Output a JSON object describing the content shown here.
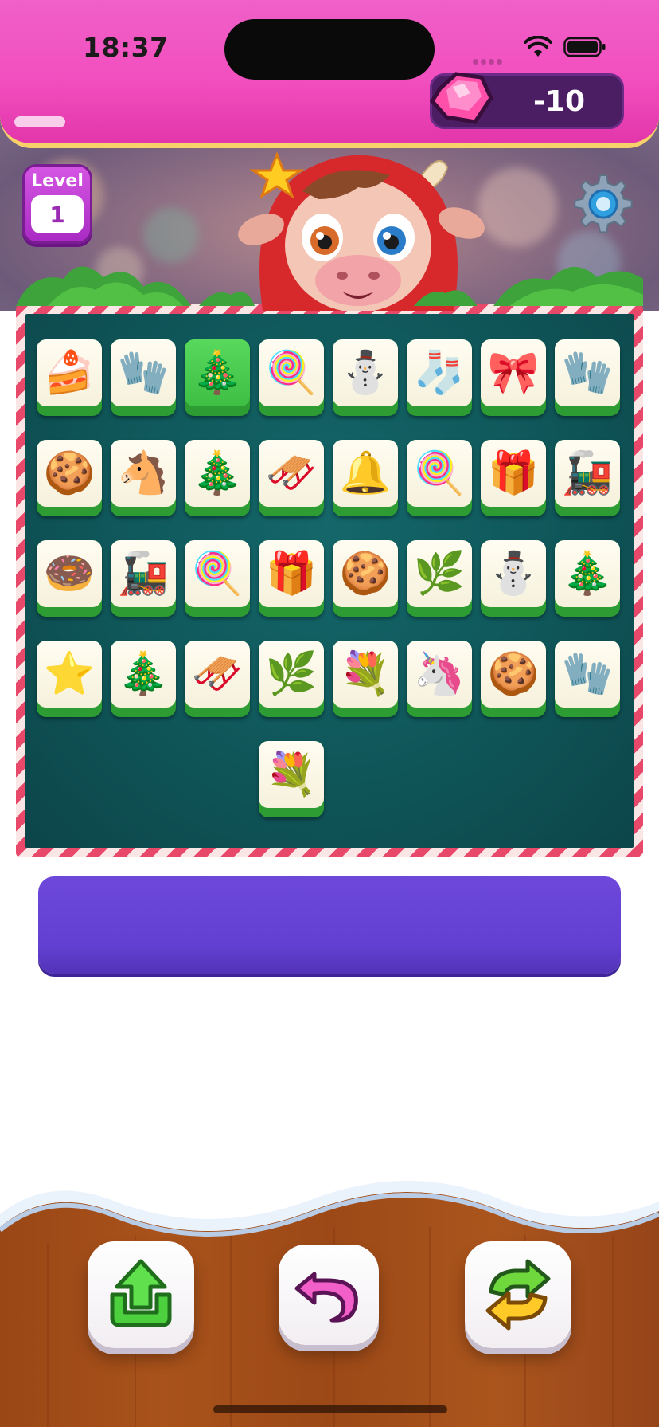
{
  "status_bar": {
    "time": "18:37"
  },
  "currency": {
    "value": "-10",
    "icon": "pink-gem-icon"
  },
  "level": {
    "label": "Level",
    "number": "1"
  },
  "settings": {
    "icon": "gear-icon"
  },
  "colors": {
    "header_pink": "#f24fbf",
    "board_teal": "#0f5659",
    "tile_green": "#2c9c33",
    "tray_purple": "#6340d2",
    "wood_brown": "#a24c17"
  },
  "board": {
    "tiles": [
      {
        "glyph": "🍰",
        "name": "cake-tile",
        "active": false
      },
      {
        "glyph": "🧤",
        "name": "red-mitten-tile",
        "active": false
      },
      {
        "glyph": "🎄",
        "name": "tree-tile",
        "active": true
      },
      {
        "glyph": "🍭",
        "name": "candy-cane-tile",
        "active": false
      },
      {
        "glyph": "⛄",
        "name": "snowman-tile",
        "active": false
      },
      {
        "glyph": "🧦",
        "name": "stocking-tile",
        "active": false
      },
      {
        "glyph": "🎀",
        "name": "ornament-bow-tile",
        "active": false
      },
      {
        "glyph": "🧤",
        "name": "blue-mitten-tile",
        "active": false
      },
      {
        "glyph": "🍪",
        "name": "gingerbread-tile",
        "active": false
      },
      {
        "glyph": "🐴",
        "name": "rocking-horse-tile",
        "active": false
      },
      {
        "glyph": "🎄",
        "name": "tree-cookie-tile",
        "active": false
      },
      {
        "glyph": "🛷",
        "name": "sled-tile",
        "active": false
      },
      {
        "glyph": "🔔",
        "name": "bauble-tile",
        "active": false
      },
      {
        "glyph": "🍭",
        "name": "lollipop-tile",
        "active": false
      },
      {
        "glyph": "🎁",
        "name": "gift-tile",
        "active": false
      },
      {
        "glyph": "🚂",
        "name": "train-tile",
        "active": false
      },
      {
        "glyph": "🍩",
        "name": "donut-tile",
        "active": false
      },
      {
        "glyph": "🚂",
        "name": "train-tile",
        "active": false
      },
      {
        "glyph": "🍭",
        "name": "candy-cane-tile",
        "active": false
      },
      {
        "glyph": "🎁",
        "name": "gift-tile",
        "active": false
      },
      {
        "glyph": "🍪",
        "name": "snowman-cookie-tile",
        "active": false
      },
      {
        "glyph": "🌿",
        "name": "holly-tile",
        "active": false
      },
      {
        "glyph": "⛄",
        "name": "snowman-tile",
        "active": false
      },
      {
        "glyph": "🎄",
        "name": "tree-cookie-tile",
        "active": false
      },
      {
        "glyph": "⭐",
        "name": "star-tile",
        "active": false
      },
      {
        "glyph": "🎄",
        "name": "tree-cookie-tile",
        "active": false
      },
      {
        "glyph": "🛷",
        "name": "sled-tile",
        "active": false
      },
      {
        "glyph": "🌿",
        "name": "holly-tile",
        "active": false
      },
      {
        "glyph": "💐",
        "name": "wreath-tile",
        "active": false
      },
      {
        "glyph": "🦄",
        "name": "toy-pony-tile",
        "active": false
      },
      {
        "glyph": "🍪",
        "name": "gingerbread-tile",
        "active": false
      },
      {
        "glyph": "🧤",
        "name": "red-mitten-tile",
        "active": false
      },
      {
        "glyph": "💐",
        "name": "wreath-tile",
        "active": false
      }
    ]
  },
  "tools": {
    "move_up": {
      "icon": "move-up-arrow-icon"
    },
    "undo": {
      "icon": "undo-arrow-icon"
    },
    "shuffle": {
      "icon": "shuffle-icon"
    }
  }
}
